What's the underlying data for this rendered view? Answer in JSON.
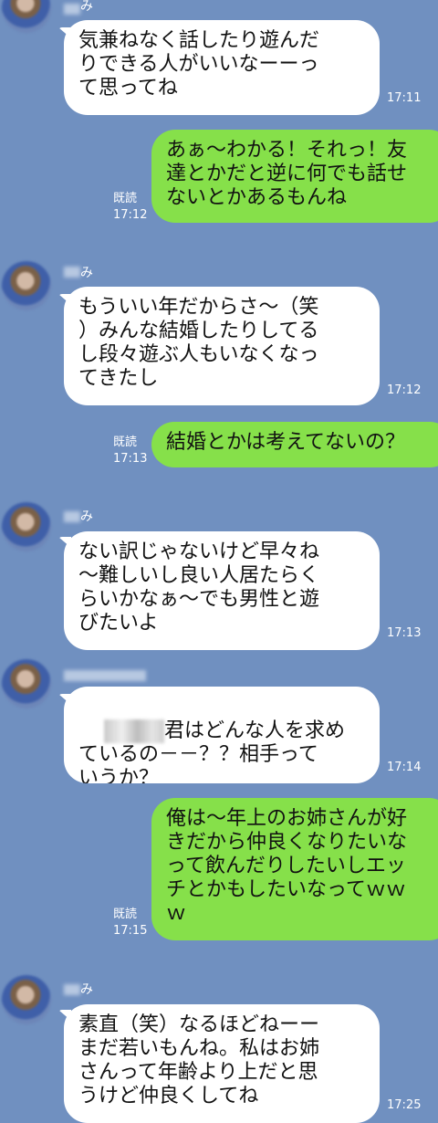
{
  "contact": {
    "name": "み"
  },
  "messages": [
    {
      "side": "left",
      "text": "気兼ねなく話したり遊んだ\nりできる人がいいなーーっ\nて思ってね",
      "time": "17:11"
    },
    {
      "side": "right",
      "text": "あぁ〜わかる！それっ！友\n達とかだと逆に何でも話せ\nないとかあるもんね",
      "read": "既読",
      "time": "17:12"
    },
    {
      "side": "left",
      "text": "もういい年だからさ〜（笑\n）みんな結婚したりしてる\nし段々遊ぶ人もいなくなっ\nてきたし",
      "time": "17:12"
    },
    {
      "side": "right",
      "text": "結婚とかは考えてないの？",
      "read": "既読",
      "time": "17:13"
    },
    {
      "side": "left",
      "text": "ない訳じゃないけど早々ね\n〜難しいし良い人居たらく\nらいかなぁ〜でも男性と遊\nびたいよ",
      "time": "17:13"
    },
    {
      "side": "left",
      "text_after_censor": "君はどんな人を求め",
      "text": "ているの－－？？相手って\nいうか？",
      "time": "17:14"
    },
    {
      "side": "right",
      "text": "俺は〜年上のお姉さんが好\nきだから仲良くなりたいな\nって飲んだりしたいしエッ\nチとかもしたいなってｗｗ\nｗ",
      "read": "既読",
      "time": "17:15"
    },
    {
      "side": "left",
      "text": "素直（笑）なるほどねーー\nまだ若いもんね。私はお姉\nさんって年齢より上だと思\nうけど仲良くしてね",
      "time": "17:25"
    }
  ]
}
